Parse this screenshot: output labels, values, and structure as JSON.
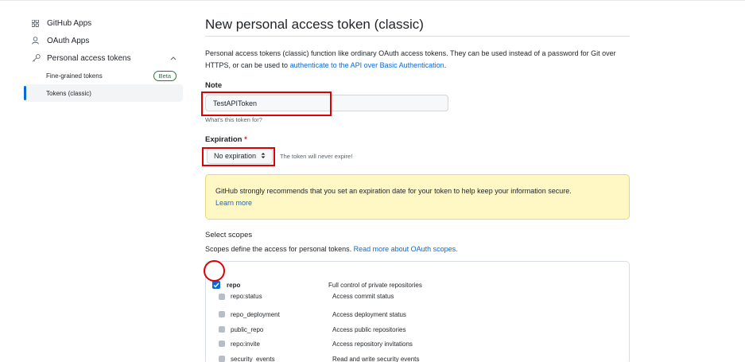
{
  "sidebar": {
    "github_apps": "GitHub Apps",
    "oauth_apps": "OAuth Apps",
    "personal_access_tokens": "Personal access tokens",
    "fine_grained_tokens": "Fine-grained tokens",
    "beta_badge": "Beta",
    "tokens_classic": "Tokens (classic)"
  },
  "main": {
    "title": "New personal access token (classic)",
    "description_prefix": "Personal access tokens (classic) function like ordinary OAuth access tokens. They can be used instead of a password for Git over HTTPS, or can be used to ",
    "description_link": "authenticate to the API over Basic Authentication",
    "description_suffix": "."
  },
  "note": {
    "label": "Note",
    "value": "TestAPIToken",
    "hint": "What's this token for?"
  },
  "expiration": {
    "label": "Expiration",
    "required_mark": "*",
    "selected": "No expiration",
    "hint": "The token will never expire!"
  },
  "warning": {
    "text": "GitHub strongly recommends that you set an expiration date for your token to help keep your information secure.",
    "link": "Learn more"
  },
  "scopes": {
    "label": "Select scopes",
    "desc_prefix": "Scopes define the access for personal tokens. ",
    "desc_link": "Read more about OAuth scopes.",
    "rows": [
      {
        "name": "repo",
        "desc": "Full control of private repositories"
      },
      {
        "name": "repo:status",
        "desc": "Access commit status"
      },
      {
        "name": "repo_deployment",
        "desc": "Access deployment status"
      },
      {
        "name": "public_repo",
        "desc": "Access public repositories"
      },
      {
        "name": "repo:invite",
        "desc": "Access repository invitations"
      },
      {
        "name": "security_events",
        "desc": "Read and write security events"
      }
    ]
  },
  "colors": {
    "accent": "#0969da",
    "annotation": "#e00000",
    "warning_bg": "#fff8c5"
  }
}
